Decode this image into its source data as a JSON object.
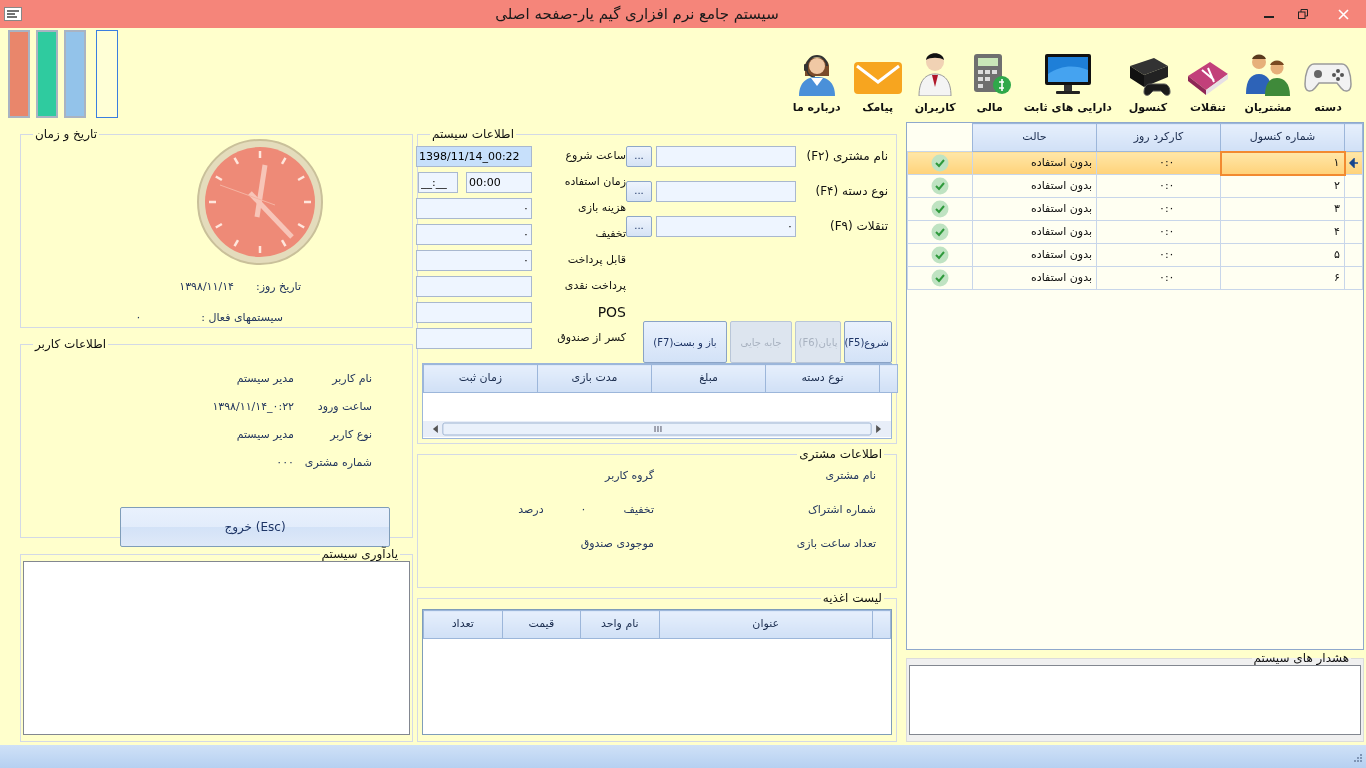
{
  "window": {
    "title": "سیستم جامع نرم افزاری گیم یار-صفحه اصلی"
  },
  "color_bars": [
    {
      "color": "#e9866b",
      "selected": false
    },
    {
      "color": "#2fcb9f",
      "selected": false
    },
    {
      "color": "#93c3ea",
      "selected": false
    },
    {
      "color": "#ffffd6",
      "selected": true
    }
  ],
  "toolbar": [
    {
      "label": "دسته"
    },
    {
      "label": "مشتریان"
    },
    {
      "label": "تنقلات"
    },
    {
      "label": "کنسول"
    },
    {
      "label": "دارایی های ثابت"
    },
    {
      "label": "مالی"
    },
    {
      "label": "کاربران"
    },
    {
      "label": "پیامک"
    },
    {
      "label": "درباره ما"
    }
  ],
  "datetime": {
    "title": "تاریخ و زمان",
    "date_label": "تاریخ روز:",
    "date": "۱۳۹۸/۱۱/۱۴",
    "active_label": "سیستمهای فعال :",
    "active": "۰"
  },
  "user_info": {
    "title": "اطلاعات کاربر",
    "rows": [
      {
        "label": "نام کاربر",
        "value": "مدیر سیستم"
      },
      {
        "label": "ساعت ورود",
        "value": "۱۳۹۸/۱۱/۱۴_۰:۲۲"
      },
      {
        "label": "نوع کاربر",
        "value": "مدیر سیستم"
      },
      {
        "label": "شماره مشتری",
        "value": "۰۰۰"
      }
    ],
    "exit_button": "(Esc) خروج"
  },
  "reminders": {
    "title": "یادآوری سیستم"
  },
  "system_info": {
    "title": "اطلاعات سیستم",
    "lookups": [
      {
        "label": "نام مشتری (F۲)",
        "button": "..."
      },
      {
        "label": "نوع دسته (F۴)",
        "button": "..."
      },
      {
        "label": "تنقلات (F۹)",
        "value": "۰",
        "button": "..."
      }
    ],
    "fields": [
      {
        "label": "ساعت شروع",
        "value": "1398/11/14_00:22",
        "selected": true
      },
      {
        "label": "زمان استفاده",
        "value": "00:00",
        "mask": "__:__",
        "selected": false
      },
      {
        "label": "هزینه بازی",
        "value": "۰",
        "selected": false
      },
      {
        "label": "تخفیف",
        "value": "۰",
        "selected": false
      },
      {
        "label": "قابل پرداخت",
        "value": "۰",
        "selected": false
      },
      {
        "label": "پرداخت نقدی",
        "selected": false
      },
      {
        "label": "POS",
        "selected": false
      },
      {
        "label": "کسر از صندوق",
        "selected": false
      }
    ],
    "buttons": [
      {
        "label": "شروع(F5)",
        "disabled": false
      },
      {
        "label": "پایان(F6)",
        "disabled": true
      },
      {
        "label": "جابه جایی",
        "disabled": true
      },
      {
        "label": "باز و بست(F7)",
        "disabled": false
      }
    ],
    "table": {
      "columns": [
        "نوع دسته",
        "مبلغ",
        "مدت بازی",
        "زمان ثبت"
      ]
    }
  },
  "customer_info": {
    "title": "اطلاعات مشتری",
    "items": [
      {
        "label": "نام مشتری"
      },
      {
        "label": "گروه کاربر"
      },
      {
        "label": "شماره اشتراک"
      },
      {
        "label": "تخفیف",
        "value": "۰",
        "unit": "درصد"
      },
      {
        "label": "تعداد ساعت بازی"
      },
      {
        "label": "موجودی صندوق"
      }
    ]
  },
  "food_list": {
    "title": "لیست اغذیه",
    "columns": [
      "عنوان",
      "نام واحد",
      "قیمت",
      "تعداد"
    ]
  },
  "consoles": {
    "columns": [
      "شماره کنسول",
      "کارکرد روز",
      "حالت"
    ],
    "rows": [
      {
        "number": "۱",
        "usage": "۰:۰",
        "status": "بدون استفاده",
        "available": true,
        "selected": true
      },
      {
        "number": "۲",
        "usage": "۰:۰",
        "status": "بدون استفاده",
        "available": true,
        "selected": false
      },
      {
        "number": "۳",
        "usage": "۰:۰",
        "status": "بدون استفاده",
        "available": true,
        "selected": false
      },
      {
        "number": "۴",
        "usage": "۰:۰",
        "status": "بدون استفاده",
        "available": true,
        "selected": false
      },
      {
        "number": "۵",
        "usage": "۰:۰",
        "status": "بدون استفاده",
        "available": true,
        "selected": false
      },
      {
        "number": "۶",
        "usage": "۰:۰",
        "status": "بدون استفاده",
        "available": true,
        "selected": false
      }
    ]
  },
  "alerts": {
    "title": "هشدار های سیستم"
  }
}
